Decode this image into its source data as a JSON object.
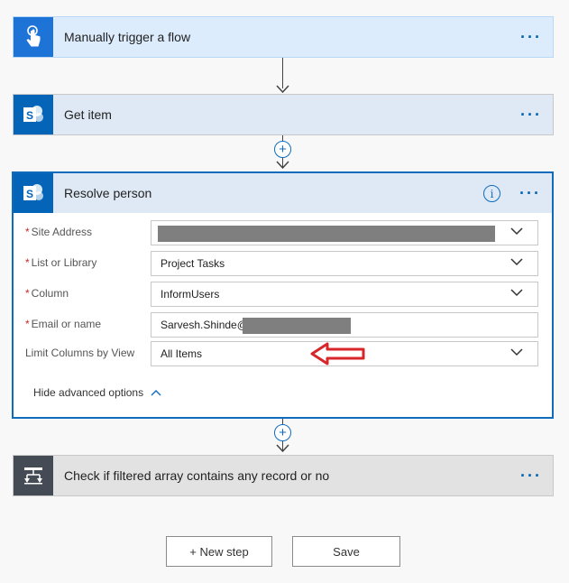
{
  "steps": {
    "trigger": {
      "title": "Manually trigger a flow",
      "more": "···",
      "icon": "touch-hand-icon"
    },
    "get_item": {
      "title": "Get item",
      "more": "···",
      "icon": "sharepoint-icon"
    },
    "resolve": {
      "title": "Resolve person",
      "more": "···",
      "info": "i",
      "icon": "sharepoint-icon",
      "fields": [
        {
          "label": "Site Address",
          "required": true,
          "value": "",
          "redacted": true,
          "dropdown": true
        },
        {
          "label": "List or Library",
          "required": true,
          "value": "Project Tasks",
          "dropdown": true
        },
        {
          "label": "Column",
          "required": true,
          "value": "InformUsers",
          "dropdown": true
        },
        {
          "label": "Email or name",
          "required": true,
          "value": "Sarvesh.Shinde@",
          "redacted": true,
          "dropdown": false
        },
        {
          "label": "Limit Columns by View",
          "required": false,
          "value": "All Items",
          "dropdown": true
        }
      ],
      "advanced_toggle": "Hide advanced options"
    },
    "check": {
      "title": "Check if filtered array contains any record or no",
      "more": "···",
      "icon": "filter-array-icon"
    }
  },
  "footer": {
    "new_step": "+ New step",
    "save": "Save"
  },
  "colors": {
    "accent": "#0f6cbd",
    "required": "#c62828",
    "annotation_arrow": "#d9262b"
  }
}
